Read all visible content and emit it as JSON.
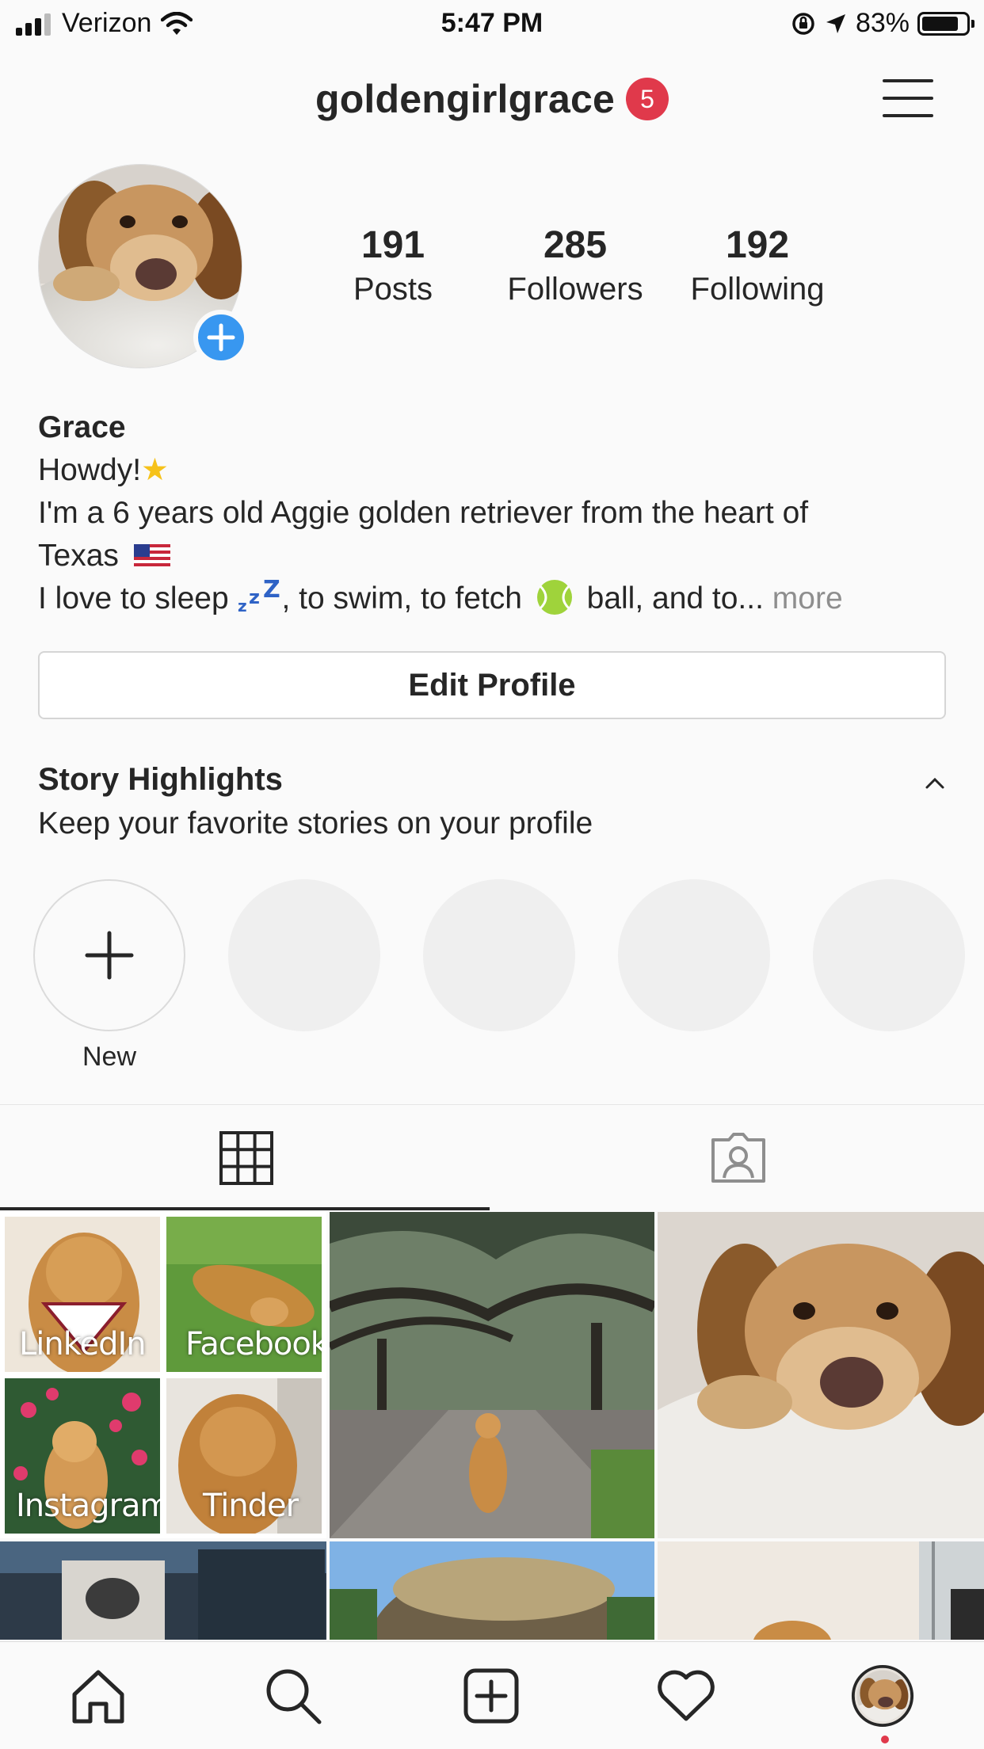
{
  "status_bar": {
    "carrier": "Verizon",
    "time": "5:47 PM",
    "battery": "83%",
    "battery_level": 0.83
  },
  "header": {
    "username": "goldengirlgrace",
    "notification_count": "5"
  },
  "profile": {
    "stats": [
      {
        "value": "191",
        "label": "Posts"
      },
      {
        "value": "285",
        "label": "Followers"
      },
      {
        "value": "192",
        "label": "Following"
      }
    ],
    "bio": {
      "name": "Grace",
      "line1": "Howdy!",
      "line2": "I'm a 6 years old Aggie golden retriever from the heart of",
      "line3": "Texas",
      "line4_a": "I love to sleep",
      "line4_b": ", to swim, to fetch",
      "line4_c": "ball, and to...",
      "more": "more"
    },
    "edit_profile_label": "Edit Profile"
  },
  "highlights": {
    "title": "Story Highlights",
    "subtitle": "Keep your favorite stories on your profile",
    "new_label": "New"
  },
  "grid": {
    "collage_labels": [
      "LinkedIn",
      "Facebook",
      "Instagram",
      "Tinder"
    ]
  },
  "colors": {
    "accent_blue": "#3897f0",
    "badge_red": "#e0394b",
    "text": "#262626",
    "muted": "#8e8e8e"
  }
}
